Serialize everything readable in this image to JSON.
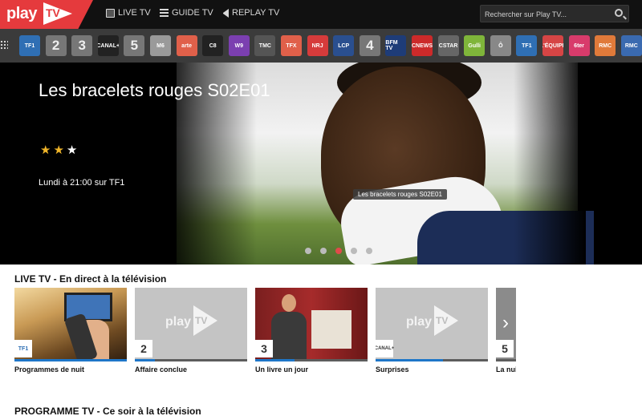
{
  "header": {
    "logo_play": "play",
    "logo_tv": "TV",
    "nav": [
      {
        "label": "LIVE TV",
        "icon": "tv-icon"
      },
      {
        "label": "GUIDE TV",
        "icon": "list-icon"
      },
      {
        "label": "REPLAY TV",
        "icon": "replay-icon"
      }
    ],
    "search_placeholder": "Rechercher sur Play TV..."
  },
  "channels": [
    {
      "label": "TF1",
      "bg": "#2f6fb4"
    },
    {
      "label": "2",
      "bg": "#777777"
    },
    {
      "label": "3",
      "bg": "#777777"
    },
    {
      "label": "CANAL+",
      "bg": "#222222"
    },
    {
      "label": "5",
      "bg": "#777777"
    },
    {
      "label": "M6",
      "bg": "#9a9a9a"
    },
    {
      "label": "arte",
      "bg": "#e0604a"
    },
    {
      "label": "C8",
      "bg": "#222222"
    },
    {
      "label": "W9",
      "bg": "#7b3fb0"
    },
    {
      "label": "TMC",
      "bg": "#555555"
    },
    {
      "label": "TFX",
      "bg": "#e0604a"
    },
    {
      "label": "NRJ",
      "bg": "#d63b3b"
    },
    {
      "label": "LCP",
      "bg": "#2a4f8f"
    },
    {
      "label": "4",
      "bg": "#777777"
    },
    {
      "label": "BFM TV",
      "bg": "#1e3c78"
    },
    {
      "label": "CNEWS",
      "bg": "#cc2a2a"
    },
    {
      "label": "CSTAR",
      "bg": "#666666"
    },
    {
      "label": "Gulli",
      "bg": "#7fb53a"
    },
    {
      "label": "Ô",
      "bg": "#888888"
    },
    {
      "label": "TF1",
      "bg": "#2f6fb4"
    },
    {
      "label": "L'ÉQUIPE",
      "bg": "#d64545"
    },
    {
      "label": "6ter",
      "bg": "#d83b6b"
    },
    {
      "label": "RMC",
      "bg": "#e07a3a"
    },
    {
      "label": "RMC",
      "bg": "#3a6ab0"
    }
  ],
  "hero": {
    "title": "Les bracelets rouges S02E01",
    "rating": 2,
    "rating_max": 3,
    "time": "Lundi à 21:00 sur TF1",
    "tooltip": "Les bracelets rouges S02E01",
    "slides": 5,
    "active_slide": 3
  },
  "live": {
    "title": "LIVE TV - En direct à la télévision",
    "cards": [
      {
        "label": "Programmes de nuit",
        "channel": "TF1",
        "progress": 1.0,
        "thumb": "photo-remote"
      },
      {
        "label": "Affaire conclue",
        "channel": "2",
        "progress": 0.18,
        "thumb": "placeholder"
      },
      {
        "label": "Un livre un jour",
        "channel": "3",
        "progress": 0.35,
        "thumb": "photo-presenter"
      },
      {
        "label": "Surprises",
        "channel": "CANAL+",
        "progress": 0.6,
        "thumb": "placeholder"
      },
      {
        "label": "La nuit",
        "channel": "5",
        "progress": 0.0,
        "thumb": "next"
      }
    ]
  },
  "programme": {
    "title": "PROGRAMME TV - Ce soir à la télévision"
  }
}
